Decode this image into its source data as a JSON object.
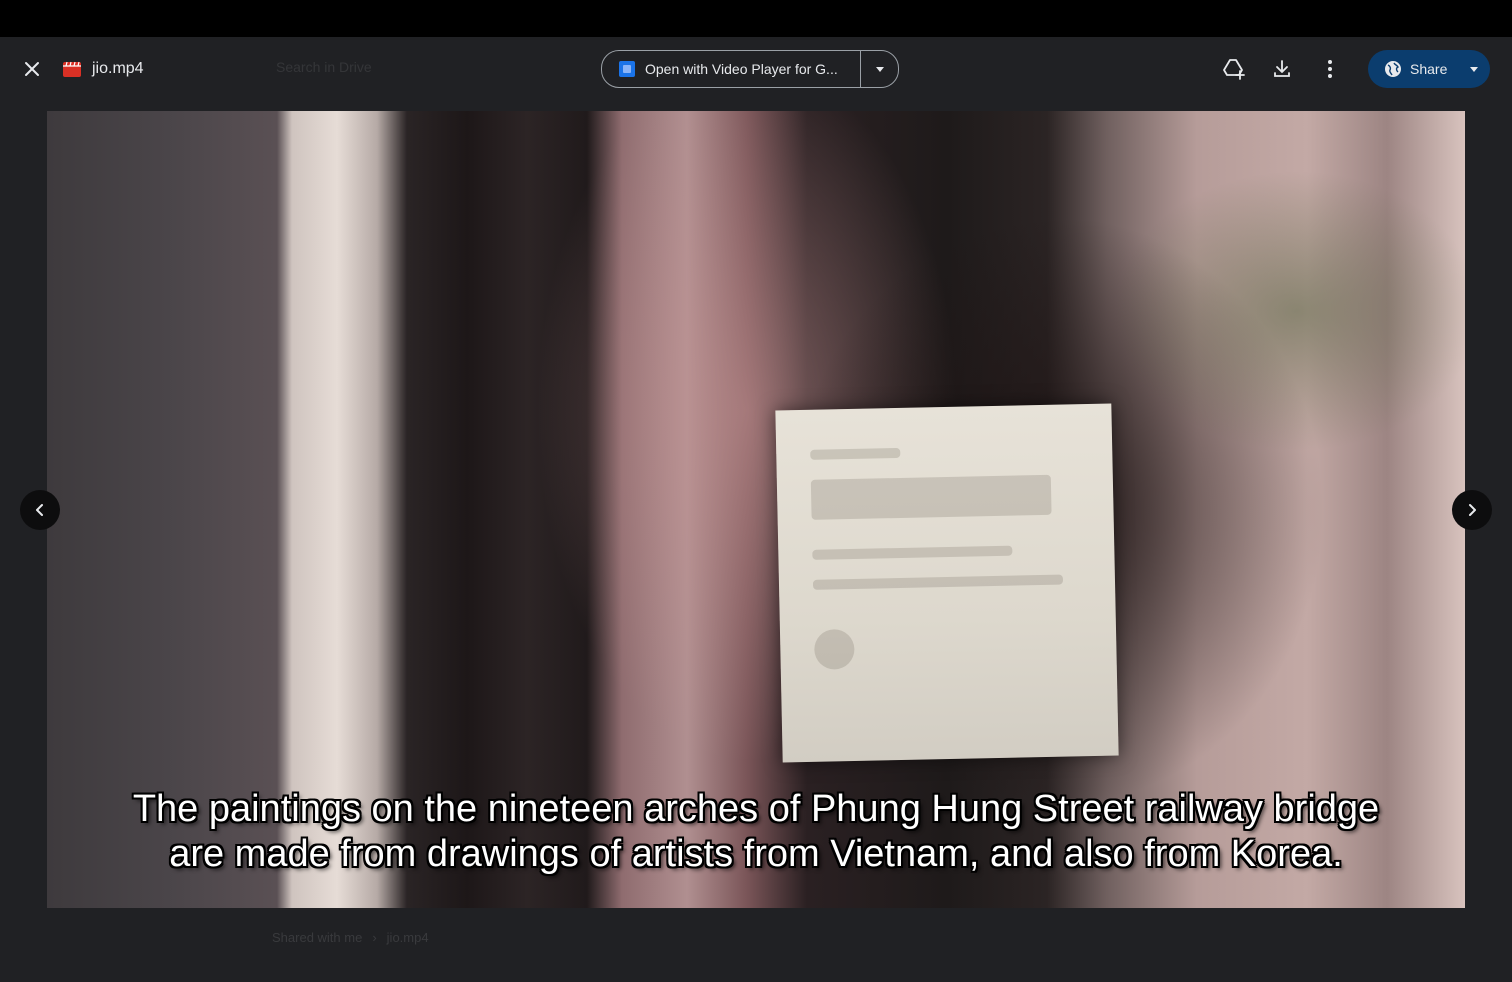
{
  "header": {
    "file_name": "jio.mp4",
    "open_with_label": "Open with Video Player for G...",
    "share_label": "Share",
    "background_search_placeholder": "Search in Drive"
  },
  "icons": {
    "close": "close-icon",
    "file_type": "video-file-icon",
    "open_with_app": "video-player-app-icon",
    "open_with_dropdown": "caret-down-icon",
    "add_to_drive": "add-to-drive-icon",
    "download": "download-icon",
    "more": "more-vert-icon",
    "share_globe": "globe-icon",
    "share_dropdown": "caret-down-icon",
    "previous": "chevron-left-icon",
    "next": "chevron-right-icon"
  },
  "video": {
    "subtitle_line_1": "The paintings on the nineteen arches of Phung Hung Street railway bridge",
    "subtitle_line_2": "are made from drawings of artists from Vietnam, and also from Korea."
  },
  "background_breadcrumb": {
    "folder": "Shared with me",
    "file": "jio.mp4"
  },
  "colors": {
    "viewer_background": "#202124",
    "top_strip": "#000000",
    "share_button": "#0b3d6e",
    "file_icon_red": "#d93025",
    "text_light": "#e8eaed"
  }
}
